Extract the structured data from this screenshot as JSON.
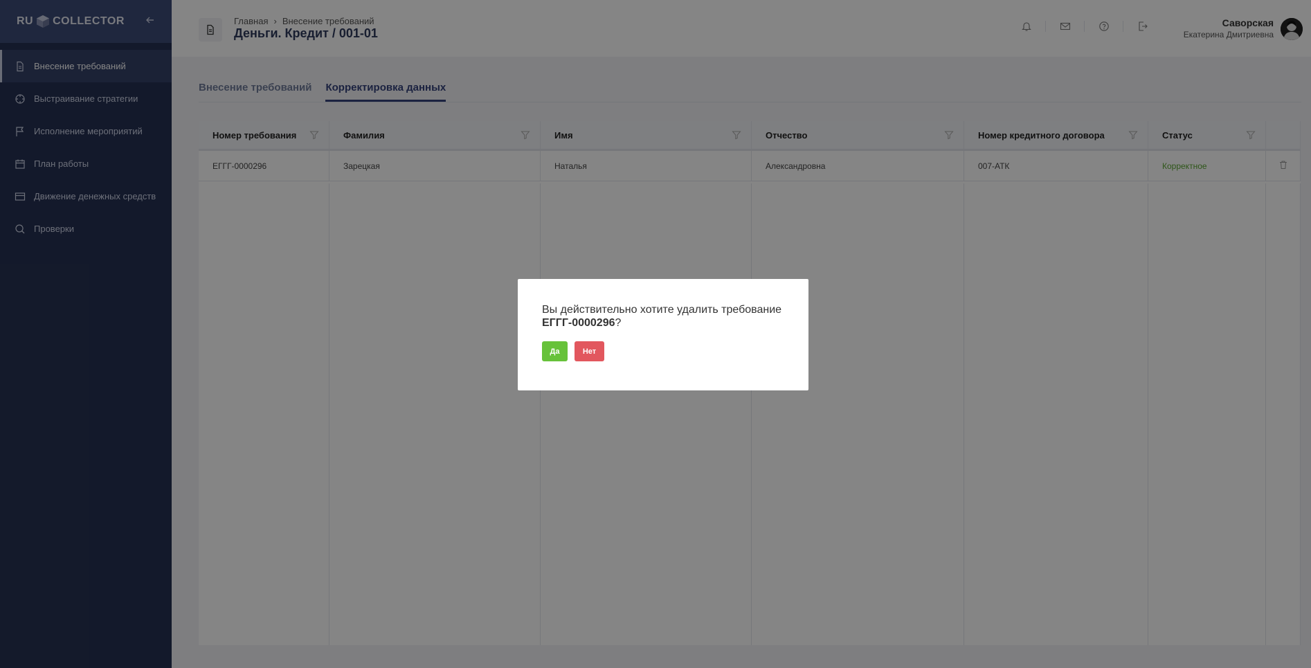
{
  "sidebar": {
    "logo_left": "RU",
    "logo_right": "COLLECTOR",
    "items": [
      {
        "label": "Внесение требований",
        "icon": "document-icon",
        "active": true
      },
      {
        "label": "Выстраивание стратегии",
        "icon": "crosshair-icon"
      },
      {
        "label": "Исполнение мероприятий",
        "icon": "flag-icon"
      },
      {
        "label": "План работы",
        "icon": "calendar-icon"
      },
      {
        "label": "Движение денежных средств",
        "icon": "card-icon"
      },
      {
        "label": "Проверки",
        "icon": "search-icon"
      }
    ]
  },
  "header": {
    "breadcrumb": [
      "Главная",
      "Внесение требований"
    ],
    "breadcrumb_separator": "›",
    "title": "Деньги. Кредит / 001-01",
    "user_last_name": "Саворская",
    "user_first_name": "Екатерина Дмитриевна",
    "icons": [
      "bell-icon",
      "mail-icon",
      "help-icon",
      "logout-icon"
    ]
  },
  "tabs": [
    {
      "label": "Внесение требований",
      "active": false
    },
    {
      "label": "Корректировка данных",
      "active": true
    }
  ],
  "table": {
    "columns": [
      "Номер требования",
      "Фамилия",
      "Имя",
      "Отчество",
      "Номер кредитного договора",
      "Статус"
    ],
    "rows": [
      {
        "number": "ЕГГГ-0000296",
        "last_name": "Зарецкая",
        "first_name": "Наталья",
        "patronymic": "Александровна",
        "contract": "007-АТК",
        "status": "Корректное"
      }
    ]
  },
  "modal": {
    "text": "Вы действительно хотите удалить требование",
    "code": "ЕГГГ-0000296",
    "suffix": "?",
    "yes_label": "Да",
    "no_label": "Нет"
  },
  "colors": {
    "sidebar_bg": "#263153",
    "accent": "#34427c",
    "status_ok": "#5aa632",
    "btn_yes": "#67c23a",
    "btn_no": "#e2575e"
  }
}
